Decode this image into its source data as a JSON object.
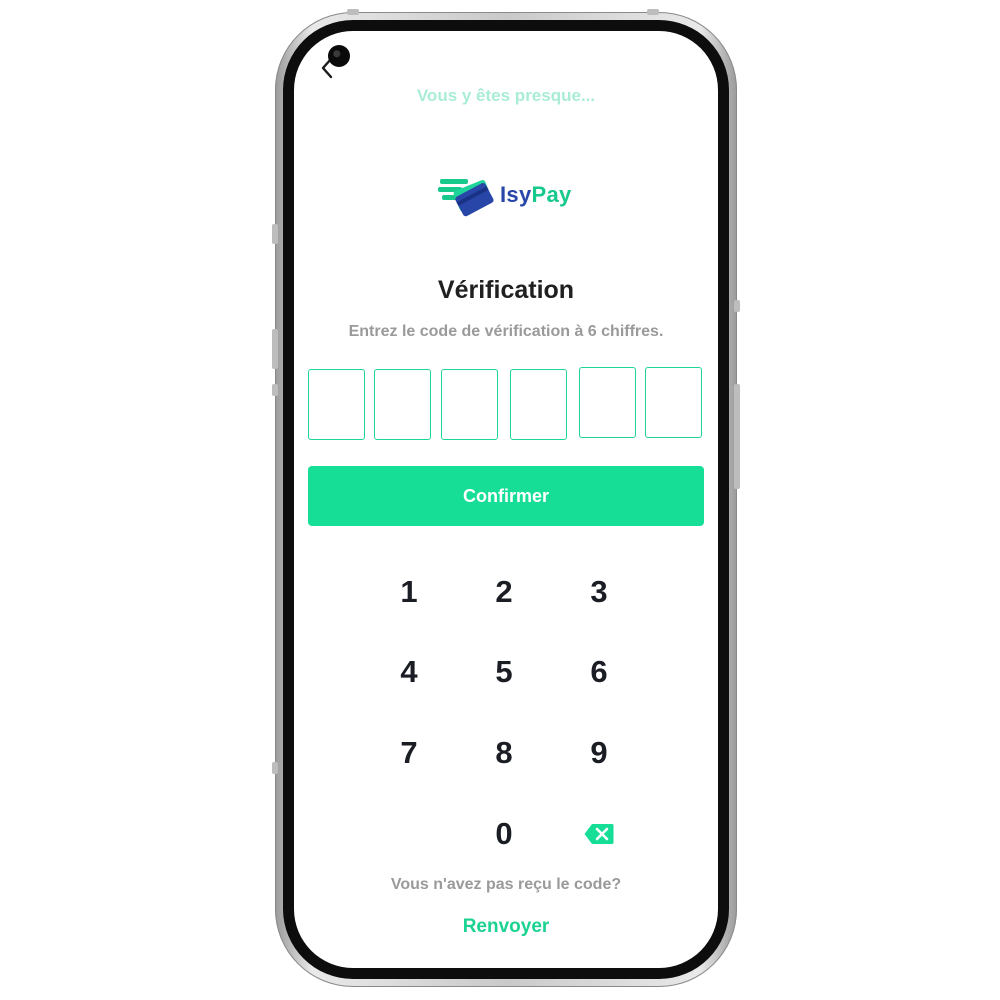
{
  "header": {
    "subtitle_top": "Vous y êtes presque..."
  },
  "brand": {
    "name_part1": "Isy",
    "name_part2": "Pay",
    "color_primary": "#2846a8",
    "color_accent": "#17c98b"
  },
  "verification": {
    "title": "Vérification",
    "instruction": "Entrez le code de vérification à 6 chiffres.",
    "code_digits": [
      "",
      "",
      "",
      "",
      "",
      ""
    ],
    "confirm_label": "Confirmer"
  },
  "keypad": {
    "keys": [
      "1",
      "2",
      "3",
      "4",
      "5",
      "6",
      "7",
      "8",
      "9",
      "0"
    ],
    "backspace_icon": "backspace-icon"
  },
  "footer": {
    "no_code_text": "Vous n'avez pas reçu le code?",
    "resend_label": "Renvoyer"
  },
  "colors": {
    "accent": "#17de97",
    "box_border": "#1fd49a",
    "muted_text": "#9a9a9a"
  }
}
